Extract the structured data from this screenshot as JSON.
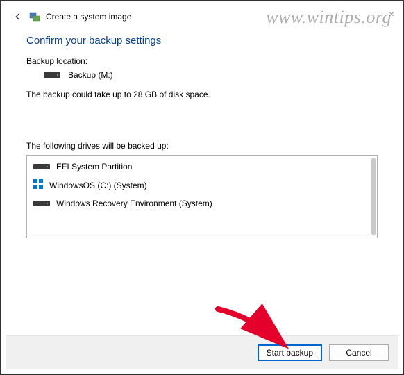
{
  "watermark": "www.wintips.org",
  "window": {
    "title": "Create a system image"
  },
  "heading": "Confirm your backup settings",
  "backup_location_label": "Backup location:",
  "backup_location_value": "Backup (M:)",
  "size_note": "The backup could take up to 28 GB of disk space.",
  "drives_label": "The following drives will be backed up:",
  "drives": [
    {
      "name": "EFI System Partition",
      "icon": "hdd"
    },
    {
      "name": "WindowsOS (C:) (System)",
      "icon": "win"
    },
    {
      "name": "Windows Recovery Environment (System)",
      "icon": "hdd"
    }
  ],
  "buttons": {
    "start": "Start backup",
    "cancel": "Cancel"
  }
}
